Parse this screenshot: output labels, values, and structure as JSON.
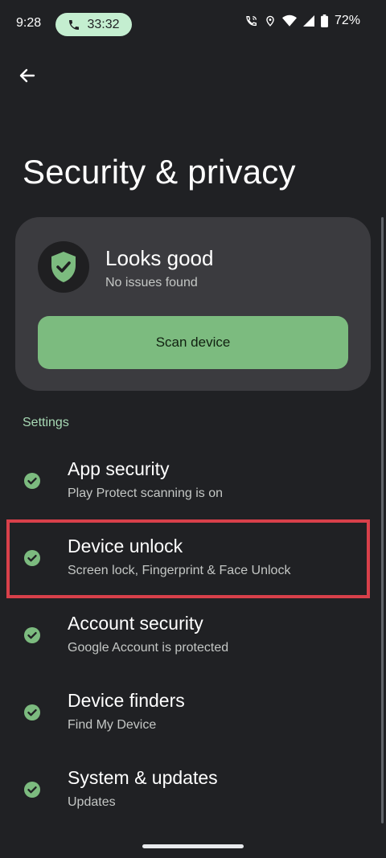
{
  "status_bar": {
    "time": "9:28",
    "call_timer": "33:32",
    "battery": "72%"
  },
  "header": {
    "title": "Security & privacy"
  },
  "status_card": {
    "title": "Looks good",
    "subtitle": "No issues found",
    "button_label": "Scan device"
  },
  "settings": {
    "section_label": "Settings",
    "items": [
      {
        "title": "App security",
        "subtitle": "Play Protect scanning is on"
      },
      {
        "title": "Device unlock",
        "subtitle": "Screen lock, Fingerprint & Face Unlock"
      },
      {
        "title": "Account security",
        "subtitle": "Google Account is protected"
      },
      {
        "title": "Device finders",
        "subtitle": "Find My Device"
      },
      {
        "title": "System & updates",
        "subtitle": "Updates"
      }
    ]
  },
  "colors": {
    "background": "#202124",
    "card": "#3b3b3f",
    "accent_green": "#7cbb7f",
    "highlight_red": "#d8404a"
  },
  "icons": [
    "phone-icon",
    "wifi-call-icon",
    "location-icon",
    "wifi-icon",
    "signal-icon",
    "battery-icon",
    "back-arrow-icon",
    "shield-check-icon",
    "check-circle-icon"
  ]
}
